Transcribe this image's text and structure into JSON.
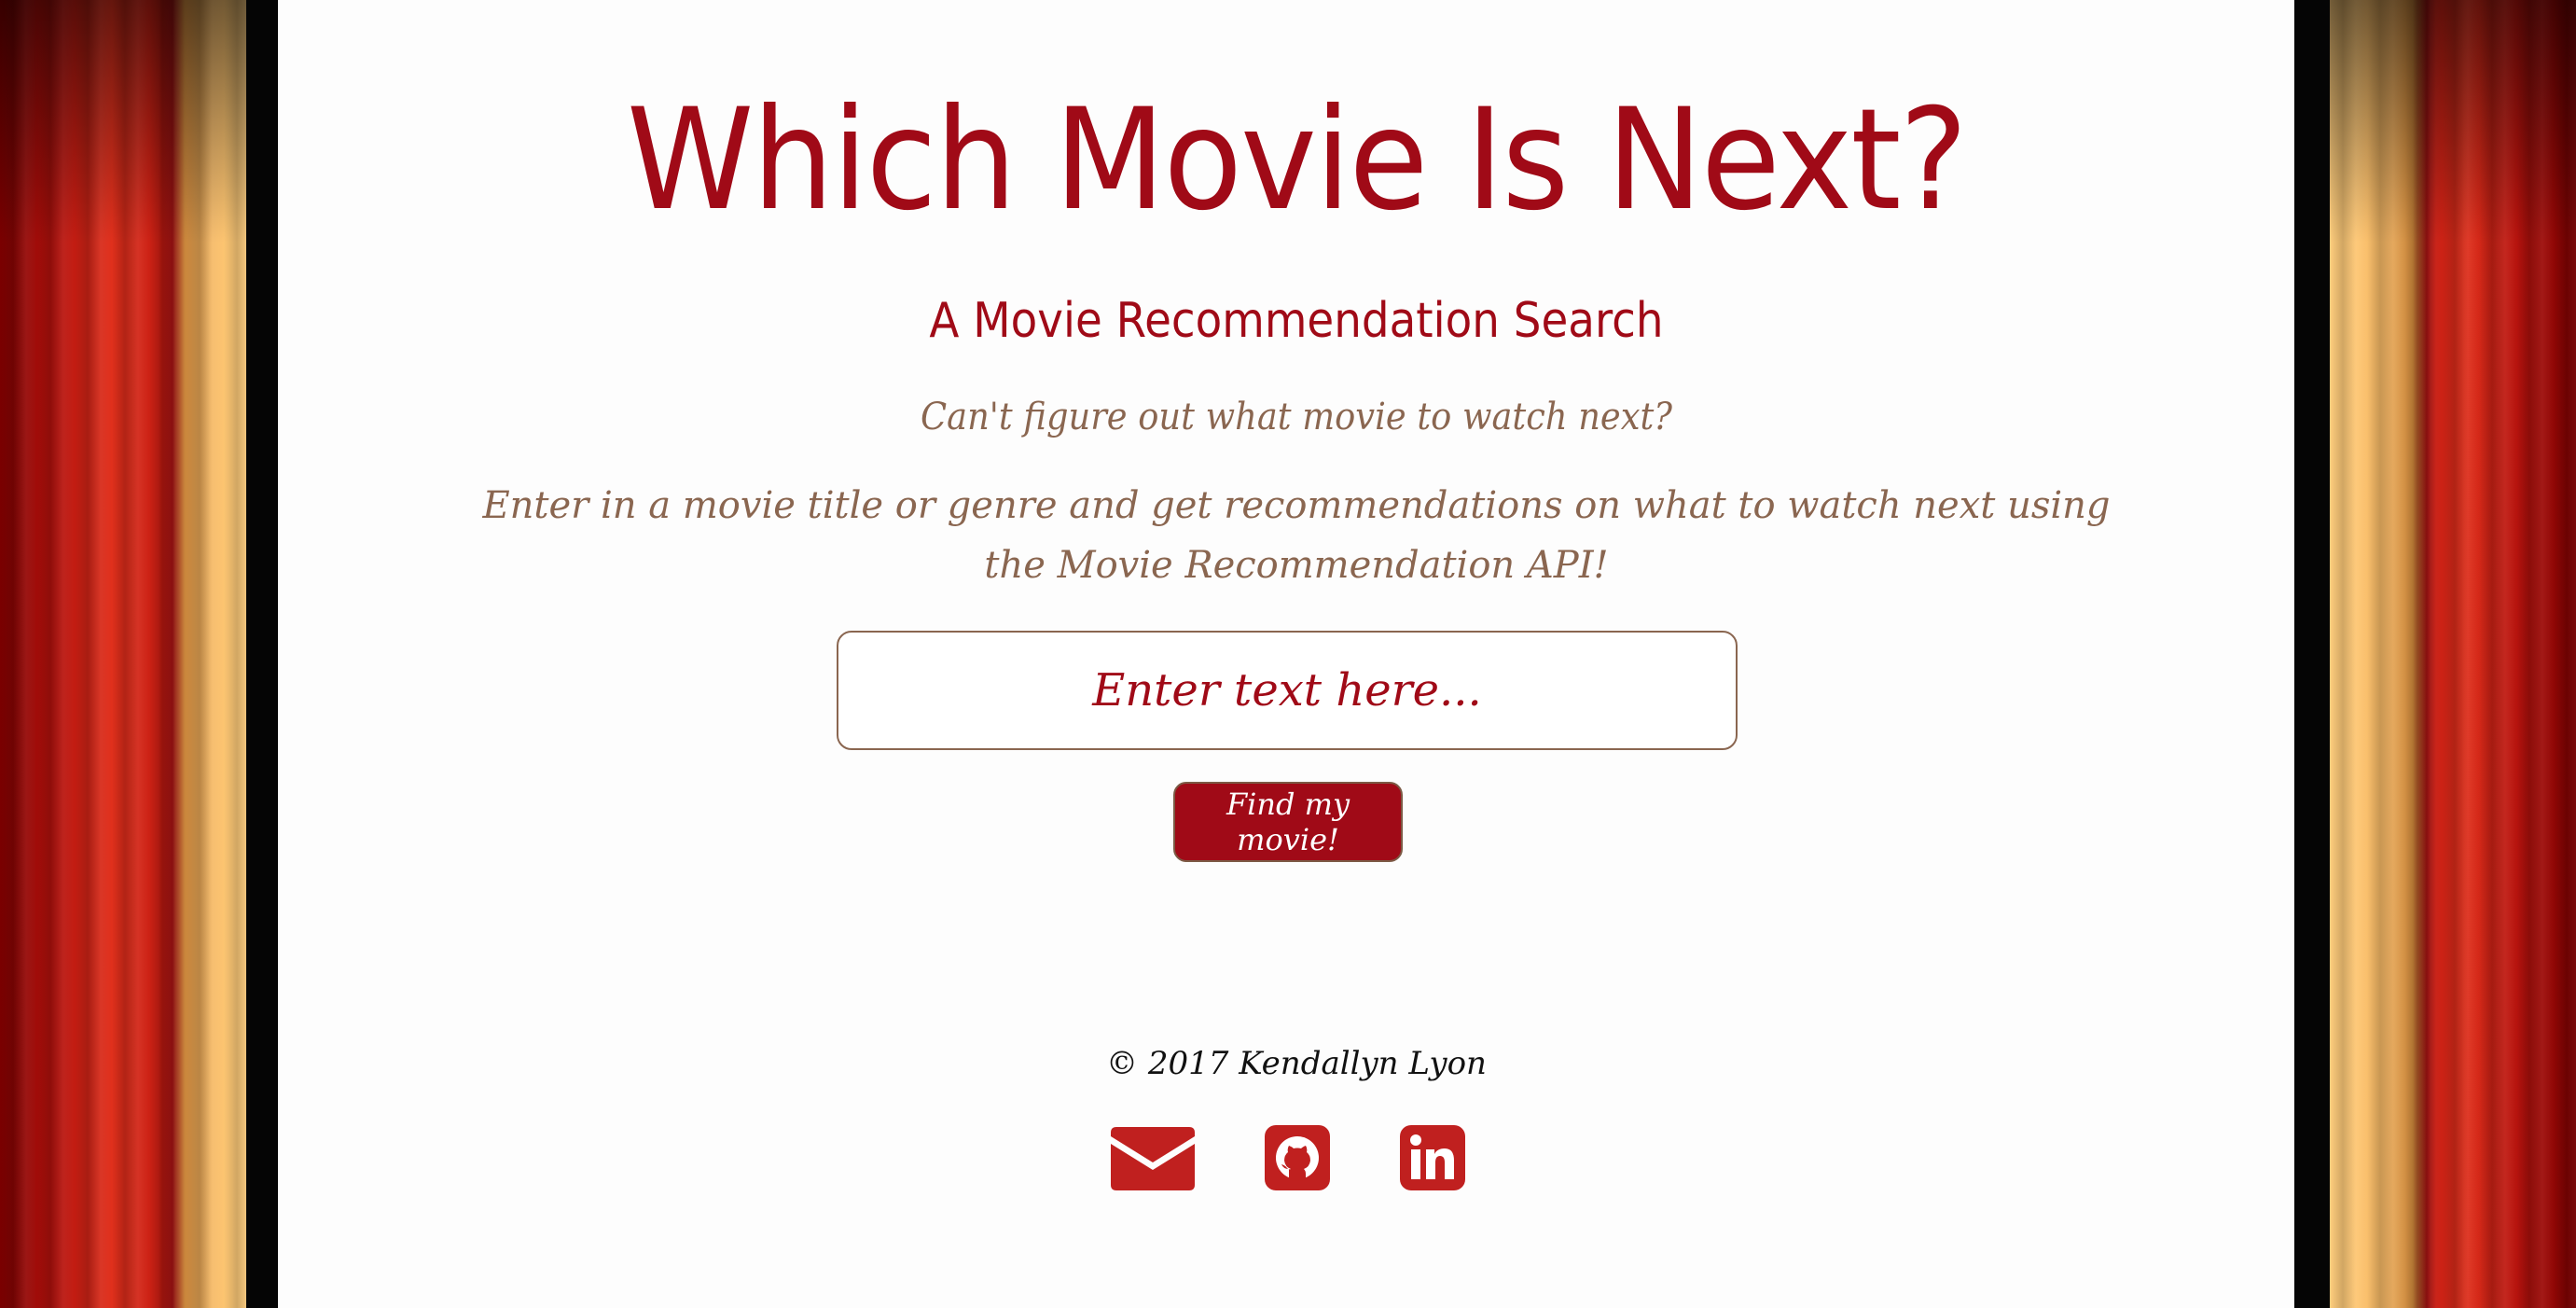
{
  "header": {
    "title": "Which Movie Is Next?",
    "subtitle": "A Movie Recommendation Search"
  },
  "intro": {
    "tagline": "Can't figure out what movie to watch next?",
    "description": "Enter in a movie title or genre and get recommendations on what to watch next using the Movie Recommendation API!"
  },
  "search": {
    "placeholder": "Enter text here...",
    "value": ""
  },
  "button": {
    "label": "Find my movie!"
  },
  "footer": {
    "copyright": "© 2017 Kendallyn Lyon",
    "social_icons": [
      "mail-icon",
      "github-icon",
      "linkedin-icon"
    ]
  },
  "colors": {
    "brand_red": "#a00a17",
    "text_brown": "#8a6650",
    "icon_red": "#c0201f",
    "panel_bg": "#fdfdfd"
  }
}
